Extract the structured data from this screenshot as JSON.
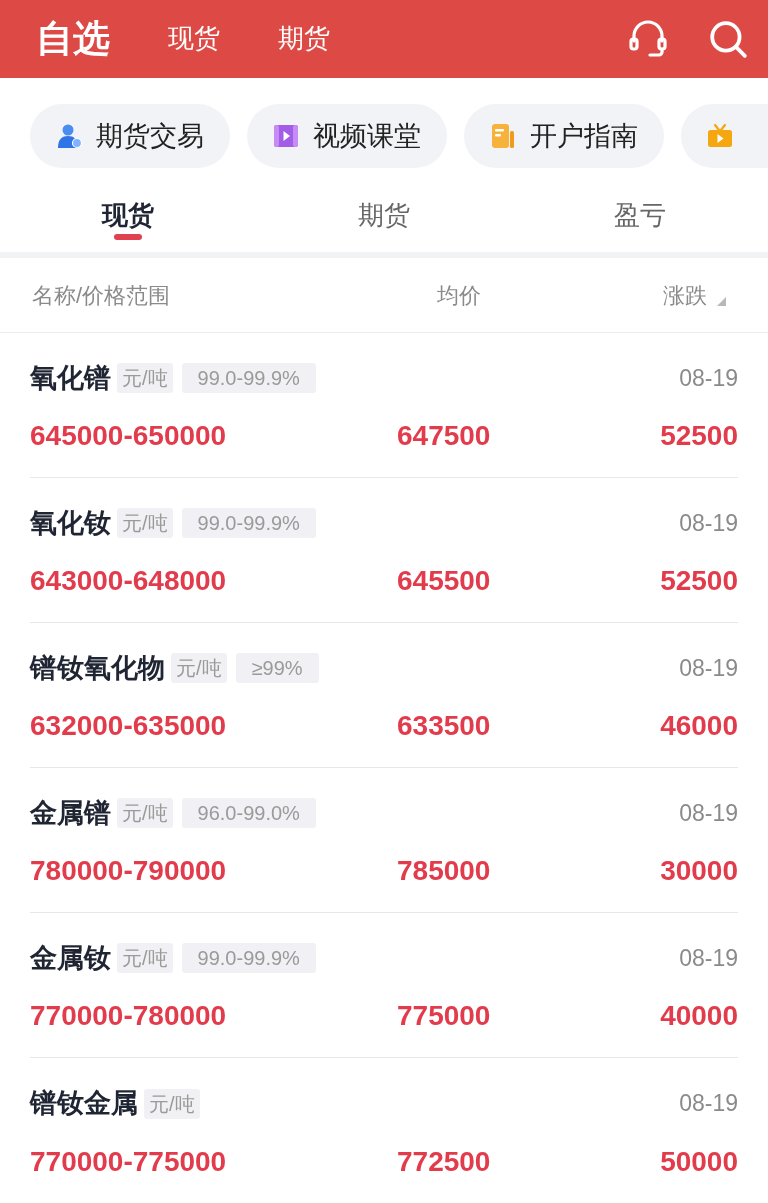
{
  "header": {
    "tabs": [
      {
        "label": "自选",
        "selected": true
      },
      {
        "label": "现货",
        "selected": false
      },
      {
        "label": "期货",
        "selected": false
      }
    ]
  },
  "shortcuts": {
    "items": [
      {
        "label": "期货交易"
      },
      {
        "label": "视频课堂"
      },
      {
        "label": "开户指南"
      }
    ],
    "more_cut_off": true
  },
  "tabs": [
    {
      "label": "现货",
      "selected": true
    },
    {
      "label": "期货",
      "selected": false
    },
    {
      "label": "盈亏",
      "selected": false
    }
  ],
  "table": {
    "columns": [
      {
        "label": "名称/价格范围",
        "sortable": false
      },
      {
        "label": "均价",
        "sortable": false
      },
      {
        "label": "涨跌",
        "sortable": true
      }
    ],
    "rows": [
      {
        "name": "氧化镨",
        "unit": "元/吨",
        "spec": "99.0-99.9%",
        "date": "08-19",
        "range": "645000-650000",
        "avg": "647500",
        "change": "52500"
      },
      {
        "name": "氧化钕",
        "unit": "元/吨",
        "spec": "99.0-99.9%",
        "date": "08-19",
        "range": "643000-648000",
        "avg": "645500",
        "change": "52500"
      },
      {
        "name": "镨钕氧化物",
        "unit": "元/吨",
        "spec": "≥99%",
        "date": "08-19",
        "range": "632000-635000",
        "avg": "633500",
        "change": "46000"
      },
      {
        "name": "金属镨",
        "unit": "元/吨",
        "spec": "96.0-99.0%",
        "date": "08-19",
        "range": "780000-790000",
        "avg": "785000",
        "change": "30000"
      },
      {
        "name": "金属钕",
        "unit": "元/吨",
        "spec": "99.0-99.9%",
        "date": "08-19",
        "range": "770000-780000",
        "avg": "775000",
        "change": "40000"
      },
      {
        "name": "镨钕金属",
        "unit": "元/吨",
        "date": "08-19",
        "range": "770000-775000",
        "avg": "772500",
        "change": "50000"
      }
    ]
  }
}
